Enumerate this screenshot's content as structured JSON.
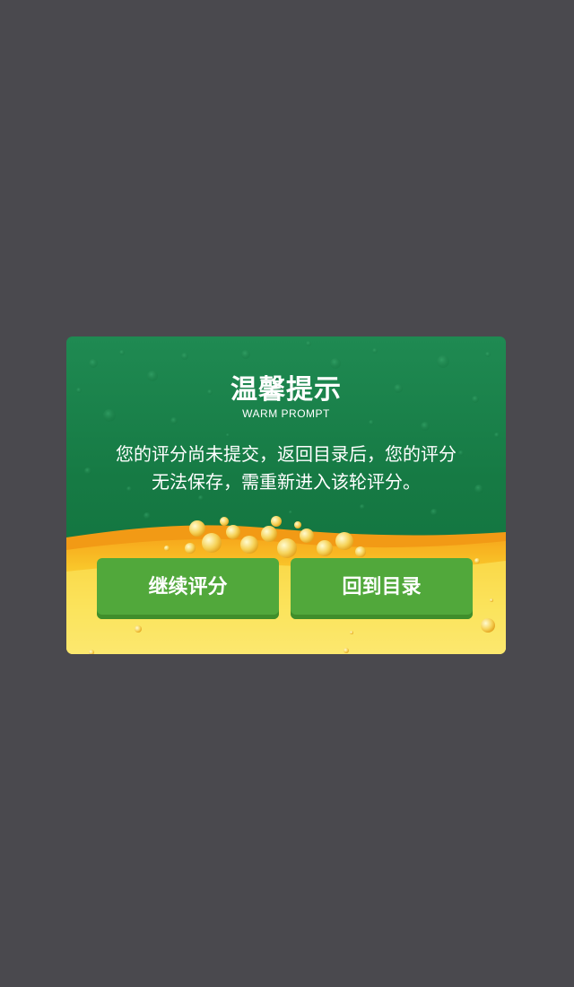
{
  "colors": {
    "overlay": "#4a494e",
    "dialog_green": "#167a44",
    "button_green": "#51a83b",
    "liquid_orange": "#f4a51a",
    "liquid_yellow": "#fbe35a"
  },
  "dialog": {
    "title": "温馨提示",
    "subtitle": "WARM PROMPT",
    "message_line1": "您的评分尚未提交，返回目录后，您的评分",
    "message_line2": "无法保存，需重新进入该轮评分。",
    "background_icon": "beer-bubbles-illustration"
  },
  "buttons": {
    "continue_label": "继续评分",
    "back_label": "回到目录"
  }
}
